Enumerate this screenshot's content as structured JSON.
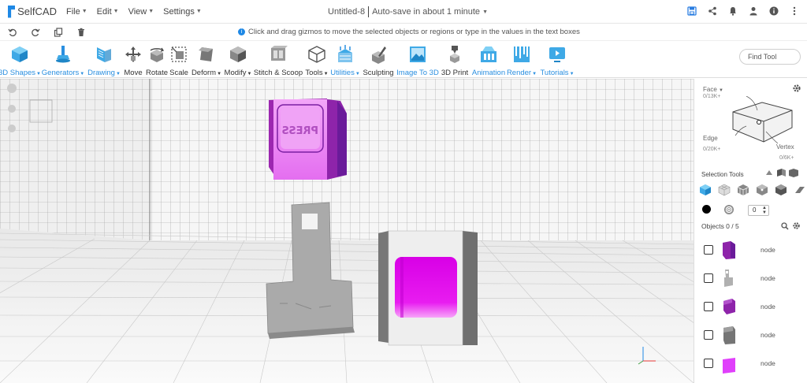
{
  "app": {
    "logo": "SelfCAD"
  },
  "menu": [
    {
      "label": "File"
    },
    {
      "label": "Edit"
    },
    {
      "label": "View"
    },
    {
      "label": "Settings"
    }
  ],
  "document": {
    "title": "Untitled-8",
    "autosave": "Auto-save in about 1 minute"
  },
  "hint": "Click and drag gizmos to move the selected objects or regions or type in the values in the text boxes",
  "toolbar": {
    "tools": [
      {
        "label": "3D Shapes",
        "dropdown": true,
        "accent": true
      },
      {
        "label": "Generators",
        "dropdown": true,
        "accent": true
      },
      {
        "label": "Drawing",
        "dropdown": true,
        "accent": true
      },
      {
        "label": "Move",
        "dropdown": false,
        "accent": false
      },
      {
        "label": "Rotate",
        "dropdown": false,
        "accent": false
      },
      {
        "label": "Scale",
        "dropdown": false,
        "accent": false
      },
      {
        "label": "Deform",
        "dropdown": true,
        "accent": false
      },
      {
        "label": "Modify",
        "dropdown": true,
        "accent": false
      },
      {
        "label": "Stitch & Scoop",
        "dropdown": false,
        "accent": false
      },
      {
        "label": "Tools",
        "dropdown": true,
        "accent": false
      },
      {
        "label": "Utilities",
        "dropdown": true,
        "accent": true
      },
      {
        "label": "Sculpting",
        "dropdown": false,
        "accent": false
      },
      {
        "label": "Image To 3D",
        "dropdown": false,
        "accent": true
      },
      {
        "label": "3D Print",
        "dropdown": false,
        "accent": false
      },
      {
        "label": "Animation",
        "dropdown": false,
        "accent": true
      },
      {
        "label": "Render",
        "dropdown": true,
        "accent": true
      },
      {
        "label": "Tutorials",
        "dropdown": true,
        "accent": true
      }
    ],
    "find_tool": "Find Tool"
  },
  "panel": {
    "face_label": "Face",
    "face_count": "0/13K+",
    "edge_label": "Edge",
    "edge_count": "0/20K+",
    "vertex_label": "Vertex",
    "vertex_count": "0/6K+",
    "selection_tools_label": "Selection Tools",
    "number_value": "0",
    "objects_header": "Objects 0 / 5",
    "objects": [
      {
        "name": "node",
        "color": "#8e24aa"
      },
      {
        "name": "node",
        "color": "#9e9e9e"
      },
      {
        "name": "node",
        "color": "#8e24aa"
      },
      {
        "name": "node",
        "color": "#757575"
      },
      {
        "name": "node",
        "color": "#e040fb"
      }
    ]
  },
  "colors": {
    "accent": "#2a8fe0",
    "purple": "#b44fe0",
    "magenta": "#e040fb",
    "gray_part": "#9a9a9a"
  }
}
